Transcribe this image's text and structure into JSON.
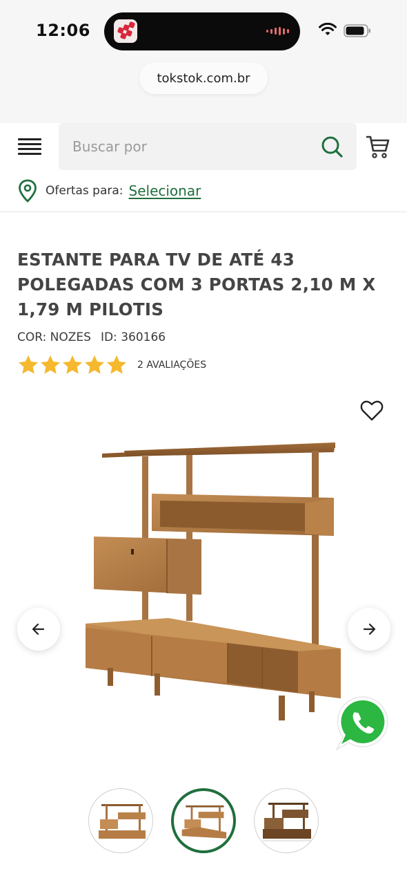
{
  "status_bar": {
    "time": "12:06"
  },
  "browser": {
    "url": "tokstok.com.br"
  },
  "header": {
    "search_placeholder": "Buscar por",
    "offers_label": "Ofertas para:",
    "offers_link": "Selecionar"
  },
  "product": {
    "title": "ESTANTE PARA TV DE ATÉ 43 POLEGADAS COM 3 PORTAS 2,10 M X 1,79 M PILOTIS",
    "color": "COR: NOZES",
    "id": "ID: 360166",
    "rating": 5,
    "reviews": "2 AVALIAÇÕES"
  },
  "gallery": {
    "thumbnails": [
      "thumb-1",
      "thumb-2",
      "thumb-3"
    ],
    "active_index": 1
  },
  "colors": {
    "brand_green": "#1f6f3d",
    "star": "#f5b82e",
    "wood": "#b07a45",
    "whatsapp": "#25d366"
  },
  "icons": [
    "menu-icon",
    "search-icon",
    "cart-icon",
    "location-pin-icon",
    "heart-icon",
    "arrow-left-icon",
    "arrow-right-icon",
    "whatsapp-icon",
    "wifi-icon",
    "battery-icon"
  ]
}
